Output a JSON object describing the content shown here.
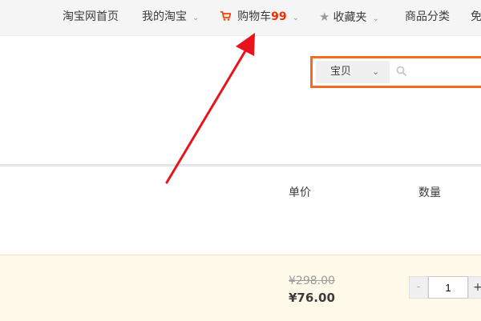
{
  "topbar": {
    "home": "淘宝网首页",
    "my_taobao": "我的淘宝",
    "cart_label": "购物车",
    "cart_count": "99",
    "favorites": "收藏夹",
    "categories": "商品分类",
    "partial": "免"
  },
  "search": {
    "type_label": "宝贝",
    "placeholder": ""
  },
  "table": {
    "headers": {
      "unit_price": "单价",
      "quantity": "数量"
    }
  },
  "item": {
    "original_price": "¥298.00",
    "current_price": "¥76.00",
    "quantity": "1",
    "minus_label": "-",
    "plus_label": "+"
  },
  "colors": {
    "accent": "#f40000",
    "search_border": "#f46d1f",
    "row_highlight": "#fef9e8"
  },
  "icons": {
    "cart": "cart-icon",
    "favorites": "star-icon",
    "search": "search-icon",
    "dropdown": "chevron-down-icon"
  }
}
